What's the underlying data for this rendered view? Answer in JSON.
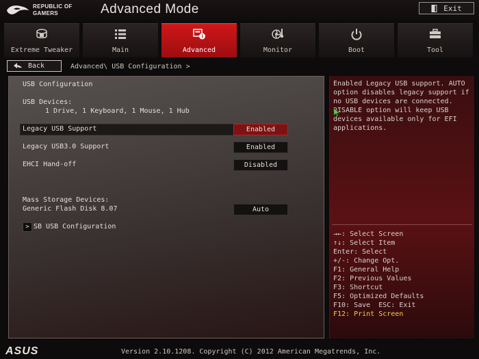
{
  "header": {
    "brand_line1": "REPUBLIC OF",
    "brand_line2": "GAMERS",
    "mode_title": "Advanced Mode",
    "exit_label": "Exit"
  },
  "tabs": [
    {
      "label": "Extreme Tweaker",
      "icon": "gauge-icon",
      "active": false
    },
    {
      "label": "Main",
      "icon": "list-icon",
      "active": false
    },
    {
      "label": "Advanced",
      "icon": "advanced-info-icon",
      "active": true
    },
    {
      "label": "Monitor",
      "icon": "monitor-fan-icon",
      "active": false
    },
    {
      "label": "Boot",
      "icon": "power-icon",
      "active": false
    },
    {
      "label": "Tool",
      "icon": "tool-icon",
      "active": false
    }
  ],
  "breadcrumb": {
    "back_label": "Back",
    "parent": "Advanced\\",
    "current": "USB Configuration >"
  },
  "main": {
    "section_title": "USB Configuration",
    "usb_devices_label": "USB Devices:",
    "usb_devices_value": "1 Drive, 1 Keyboard, 1 Mouse, 1 Hub",
    "settings": [
      {
        "label": "Legacy USB Support",
        "value": "Enabled",
        "selected": true
      },
      {
        "label": "Legacy USB3.0 Support",
        "value": "Enabled",
        "selected": false
      },
      {
        "label": "EHCI Hand-off",
        "value": "Disabled",
        "selected": false
      }
    ],
    "mass_storage_label": "Mass Storage Devices:",
    "mass_storage_device": "Generic Flash Disk 8.07",
    "mass_storage_value": "Auto",
    "submenu_label": "SB USB Configuration",
    "submenu_arrow": ">"
  },
  "help": {
    "description": "Enabled Legacy USB support. AUTO option disables legacy support if no USB devices are connected. DISABLE option will keep USB devices available only for EFI applications.",
    "keys": [
      "→←: Select Screen",
      "↑↓: Select Item",
      "Enter: Select",
      "+/-: Change Opt.",
      "F1: General Help",
      "F2: Previous Values",
      "F3: Shortcut",
      "F5: Optimized Defaults",
      "F10: Save  ESC: Exit",
      "F12: Print Screen"
    ]
  },
  "footer": {
    "logo": "ASUS",
    "version": "Version 2.10.1208. Copyright (C) 2012 American Megatrends, Inc."
  },
  "colors": {
    "accent_red": "#c81518",
    "selected_value_bg": "#7c1214",
    "highlight_key": "#f0d24a"
  }
}
